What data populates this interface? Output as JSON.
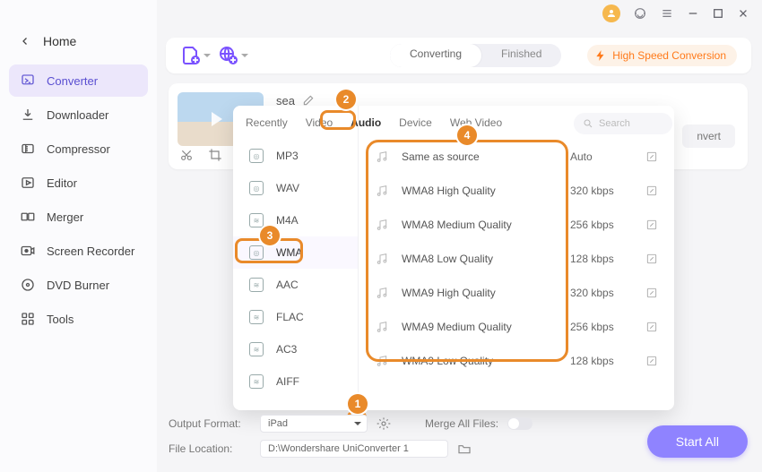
{
  "titlebar": {
    "avatar_initial": ""
  },
  "home": {
    "label": "Home"
  },
  "sidebar": {
    "items": [
      {
        "label": "Converter"
      },
      {
        "label": "Downloader"
      },
      {
        "label": "Compressor"
      },
      {
        "label": "Editor"
      },
      {
        "label": "Merger"
      },
      {
        "label": "Screen Recorder"
      },
      {
        "label": "DVD Burner"
      },
      {
        "label": "Tools"
      }
    ]
  },
  "header": {
    "seg_converting": "Converting",
    "seg_finished": "Finished",
    "high_speed": "High Speed Conversion"
  },
  "file": {
    "name": "sea",
    "convert_label": "nvert"
  },
  "popup": {
    "tabs": {
      "recently": "Recently",
      "video": "Video",
      "audio": "Audio",
      "device": "Device",
      "webvideo": "Web Video"
    },
    "search_placeholder": "Search",
    "formats": [
      {
        "label": "MP3"
      },
      {
        "label": "WAV"
      },
      {
        "label": "M4A"
      },
      {
        "label": "WMA"
      },
      {
        "label": "AAC"
      },
      {
        "label": "FLAC"
      },
      {
        "label": "AC3"
      },
      {
        "label": "AIFF"
      }
    ],
    "qualities": [
      {
        "name": "Same as source",
        "bitrate": "Auto"
      },
      {
        "name": "WMA8 High Quality",
        "bitrate": "320 kbps"
      },
      {
        "name": "WMA8 Medium Quality",
        "bitrate": "256 kbps"
      },
      {
        "name": "WMA8 Low Quality",
        "bitrate": "128 kbps"
      },
      {
        "name": "WMA9 High Quality",
        "bitrate": "320 kbps"
      },
      {
        "name": "WMA9 Medium Quality",
        "bitrate": "256 kbps"
      },
      {
        "name": "WMA9 Low Quality",
        "bitrate": "128 kbps"
      }
    ]
  },
  "bottom": {
    "output_format_label": "Output Format:",
    "output_format_value": "iPad",
    "file_location_label": "File Location:",
    "file_location_value": "D:\\Wondershare UniConverter 1",
    "merge_label": "Merge All Files:",
    "start_all": "Start All"
  },
  "callouts": {
    "c1": "1",
    "c2": "2",
    "c3": "3",
    "c4": "4"
  }
}
